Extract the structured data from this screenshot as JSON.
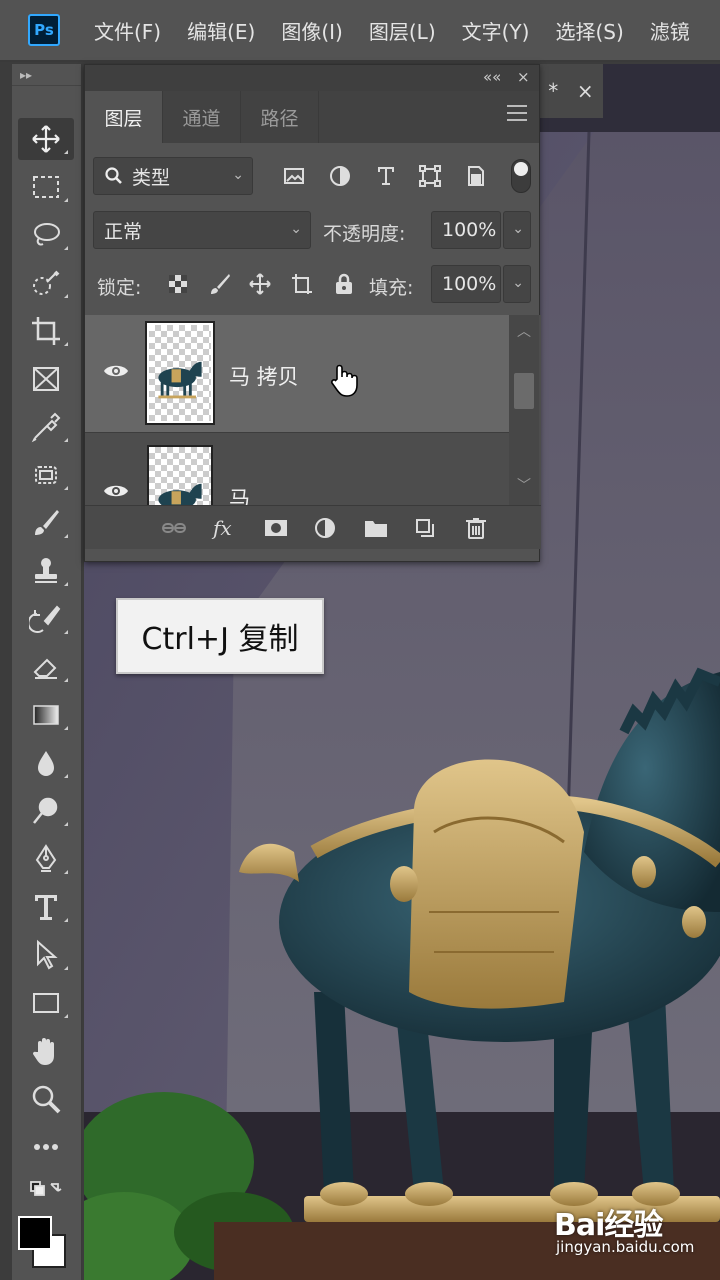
{
  "app": {
    "logo": "Ps"
  },
  "menu": [
    "文件(F)",
    "编辑(E)",
    "图像(I)",
    "图层(L)",
    "文字(Y)",
    "选择(S)",
    "滤镜"
  ],
  "document_tab": {
    "close": "×",
    "modified": "*"
  },
  "panel": {
    "collapse": "««",
    "close": "×",
    "tabs": [
      "图层",
      "通道",
      "路径"
    ],
    "active_tab": "图层",
    "filter": {
      "label": "类型",
      "icon": "search-icon"
    },
    "blend_mode": "正常",
    "opacity_label": "不透明度:",
    "opacity_value": "100%",
    "lock_label": "锁定:",
    "fill_label": "填充:",
    "fill_value": "100%",
    "layers": [
      {
        "name": "马 拷贝",
        "visible": true,
        "selected": true
      },
      {
        "name": "马",
        "visible": true,
        "selected": false
      }
    ]
  },
  "tooltip": {
    "text": "Ctrl+J 复制"
  },
  "watermark": {
    "brand": "Bai经验",
    "url": "jingyan.baidu.com"
  },
  "colors": {
    "ui_dark": "#535353",
    "selected_layer": "#676767",
    "ps_blue": "#31a8ff",
    "horse_teal": "#1f4350",
    "saddle_gold": "#c8a45c"
  }
}
